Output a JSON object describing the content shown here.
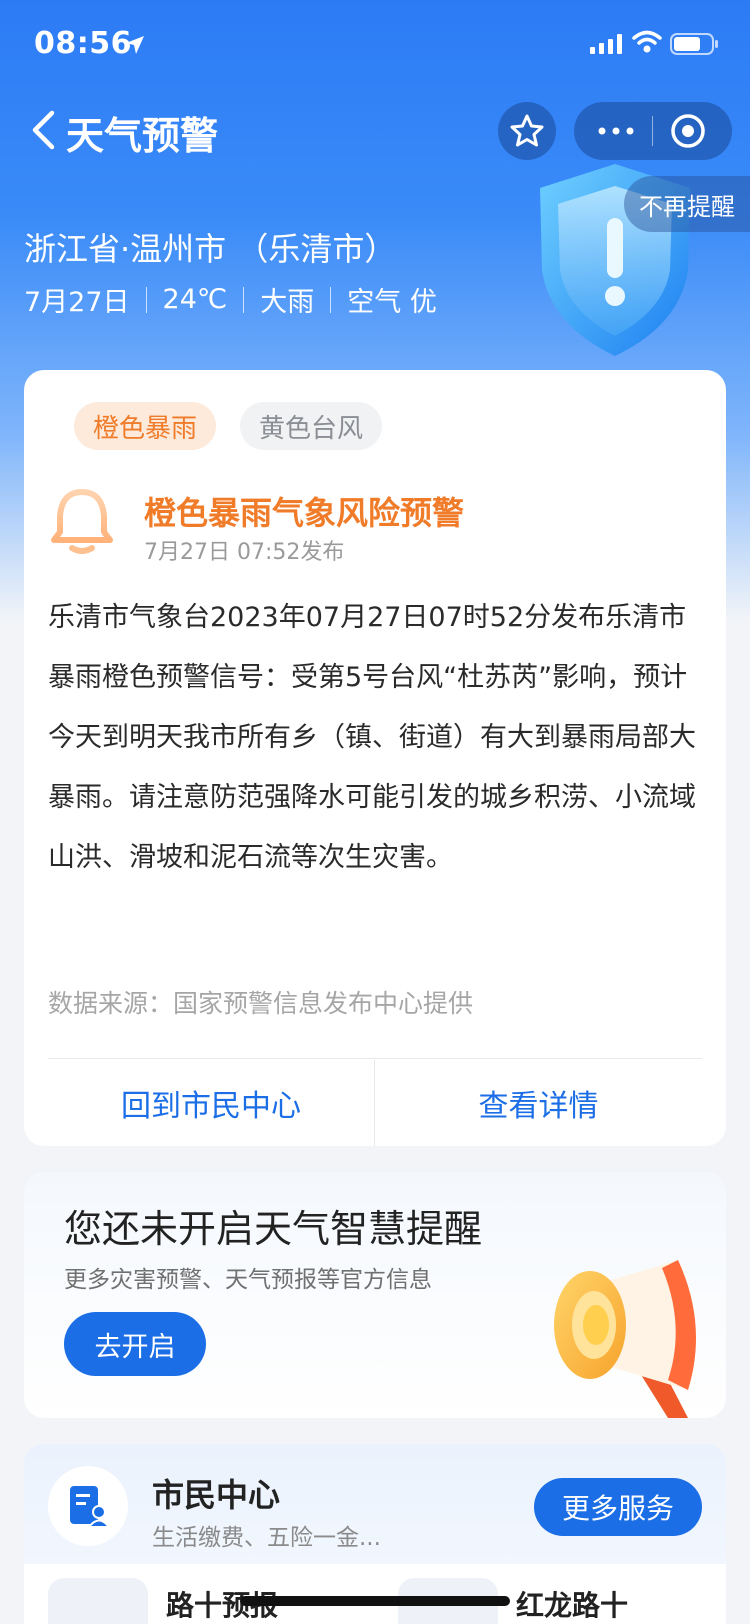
{
  "status_bar": {
    "time": "08:56"
  },
  "nav": {
    "title": "天气预警"
  },
  "dismiss_label": "不再提醒",
  "location": "浙江省·温州市 （乐清市）",
  "weather": {
    "date": "7月27日",
    "temp": "24℃",
    "condition": "大雨",
    "air": "空气 优"
  },
  "card": {
    "tags": [
      "橙色暴雨",
      "黄色台风"
    ],
    "title": "橙色暴雨气象风险预警",
    "published": "7月27日 07:52发布",
    "body": "乐清市气象台2023年07月27日07时52分发布乐清市暴雨橙色预警信号：受第5号台风“杜苏芮”影响，预计今天到明天我市所有乡（镇、街道）有大到暴雨局部大暴雨。请注意防范强降水可能引发的城乡积涝、小流域山洪、滑坡和泥石流等次生灾害。",
    "source": "数据来源：国家预警信息发布中心提供",
    "btn_back": "回到市民中心",
    "btn_detail": "查看详情"
  },
  "reminder": {
    "title": "您还未开启天气智慧提醒",
    "subtitle": "更多灾害预警、天气预报等官方信息",
    "button": "去开启"
  },
  "citizen": {
    "title": "市民中心",
    "subtitle": "生活缴费、五险一金...",
    "button": "更多服务",
    "services": [
      "路十预报",
      "红龙路十"
    ]
  },
  "colors": {
    "primary": "#1b6ee6",
    "warning_orange": "#f07c2a"
  }
}
